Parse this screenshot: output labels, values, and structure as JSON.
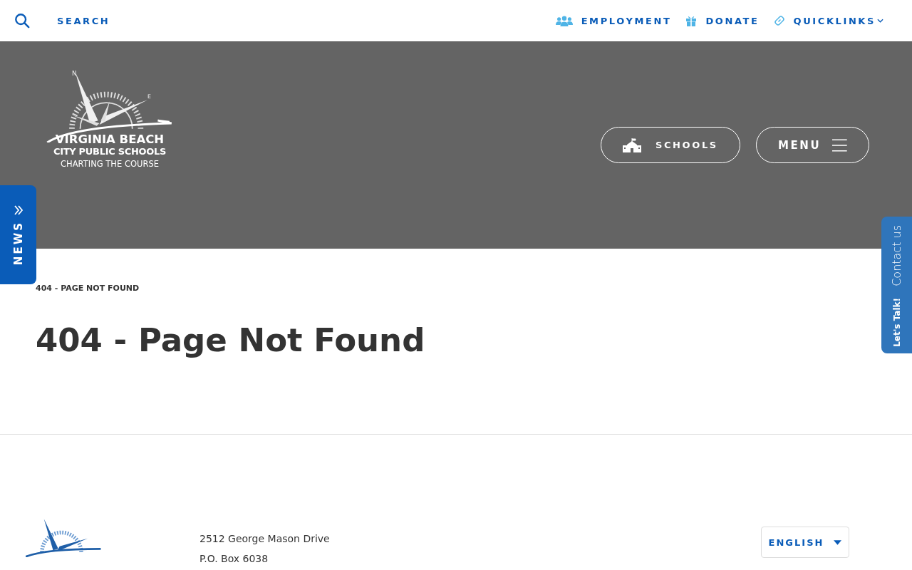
{
  "top_bar": {
    "search_label": "SEARCH",
    "links": [
      {
        "label": "EMPLOYMENT",
        "kind": "people"
      },
      {
        "label": "DONATE",
        "kind": "gift"
      },
      {
        "label": "QUICKLINKS",
        "kind": "link"
      }
    ]
  },
  "header": {
    "logo": {
      "compass_north": "N",
      "compass_east": "E",
      "line_1": "VIRGINIA BEACH",
      "line_2": "CITY PUBLIC SCHOOLS",
      "tagline": "CHARTING THE COURSE"
    },
    "schools_button": "SCHOOLS",
    "menu_button": "MENU"
  },
  "news_tab": {
    "label": "NEWS"
  },
  "contact_tab": {
    "label": "Contact us",
    "badge": "Let's Talk!"
  },
  "breadcrumb": "404 - PAGE NOT FOUND",
  "title": "404 - Page Not Found",
  "footer": {
    "address_lines": [
      "2512 George Mason Drive",
      "P.O. Box 6038"
    ],
    "language": "ENGLISH"
  }
}
